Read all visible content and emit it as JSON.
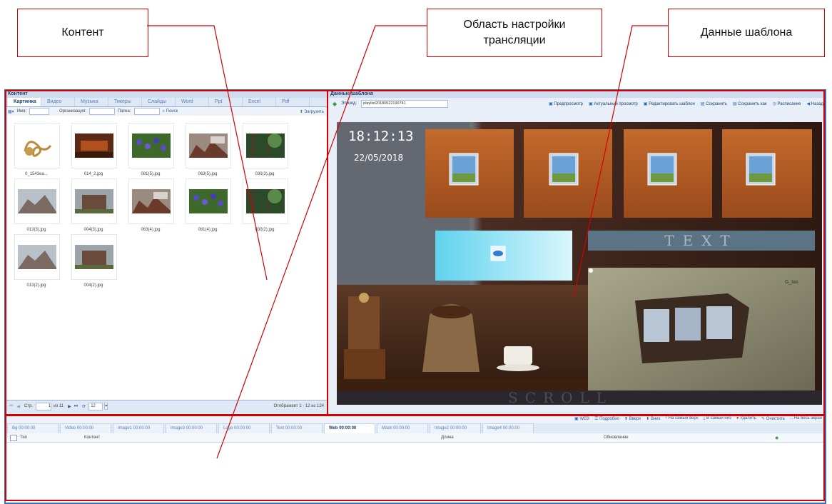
{
  "callouts": {
    "content": "Контент",
    "broadcast": "Область настройки\nтрансляции",
    "template": "Данные шаблона"
  },
  "content_panel": {
    "title": "Контент",
    "tabs": [
      "Картинка",
      "Видео",
      "Музыка",
      "Тикеры",
      "Слайды",
      "Word",
      "Ppt",
      "Excel",
      "Pdf"
    ],
    "filter": {
      "name_label": "Имя:",
      "org_label": "Организация:",
      "folder_label": "Папка:",
      "search_label": "Поиск",
      "upload_label": "Загрузить"
    },
    "thumbnails": [
      {
        "name": "0_1543ea...",
        "kind": "ornament"
      },
      {
        "name": "014_2.jpg",
        "kind": "room"
      },
      {
        "name": "081(5).jpg",
        "kind": "flowers"
      },
      {
        "name": "063(5).jpg",
        "kind": "rubble"
      },
      {
        "name": "030(3).jpg",
        "kind": "forest"
      },
      {
        "name": "013(3).jpg",
        "kind": "ruins"
      },
      {
        "name": "004(3).jpg",
        "kind": "building"
      },
      {
        "name": "063(4).jpg",
        "kind": "rubble"
      },
      {
        "name": "081(4).jpg",
        "kind": "flowers"
      },
      {
        "name": "030(2).jpg",
        "kind": "forest"
      },
      {
        "name": "013(2).jpg",
        "kind": "ruins"
      },
      {
        "name": "004(2).jpg",
        "kind": "building"
      }
    ],
    "pager": {
      "page_label": "Стр.",
      "page_value": "1",
      "of_label": "из 11",
      "per_page": "12",
      "status": "Отображает 1 - 12 из 124"
    }
  },
  "template_panel": {
    "title": "Данные шаблона",
    "alias_label": "Эпизод:",
    "alias_value": "playlist20180522190741",
    "toolbar": [
      "Предпросмотр",
      "Актуальный просмотр",
      "Редактировать шаблон",
      "Сохранить",
      "Сохранить как",
      "Расписание",
      "Назад"
    ],
    "stage": {
      "time": "18:12:13",
      "date": "22/05/2018",
      "ticker_text": "TEXT",
      "scroll_text": "SCROLL",
      "logo_text": "G_tas"
    }
  },
  "bottom_panel": {
    "toolbar": [
      "WEB",
      "Подробно",
      "Вверх",
      "Вниз",
      "На самый верх",
      "В самый низ",
      "Удалить",
      "Очистить",
      "На весь экран"
    ],
    "tabs": [
      {
        "label": "Bg 00:00:00",
        "active": false
      },
      {
        "label": "Video 00:00:00",
        "active": false
      },
      {
        "label": "Image1 00:00:00",
        "active": false
      },
      {
        "label": "Image3 00:00:00",
        "active": false
      },
      {
        "label": "Logo 00:00:00",
        "active": false
      },
      {
        "label": "Text 00:00:00",
        "active": false
      },
      {
        "label": "Web 00:00:00",
        "active": true
      },
      {
        "label": "Mask 00:00:00",
        "active": false
      },
      {
        "label": "Image2 00:00:00",
        "active": false
      },
      {
        "label": "Image4 00:00:00",
        "active": false
      }
    ],
    "columns": [
      "Тип",
      "Контент",
      "Длина",
      "Обновление"
    ]
  },
  "colors": {
    "callout_border": "#d40000",
    "frame_border": "#3b6fb2",
    "panel_bg": "#dfe8f5"
  }
}
